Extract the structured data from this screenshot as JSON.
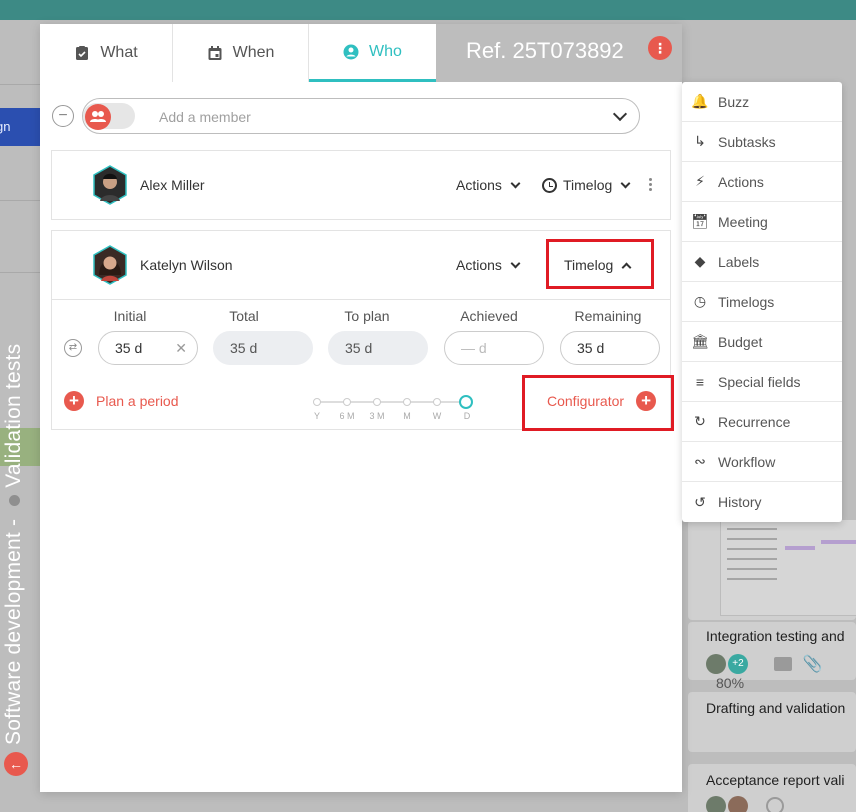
{
  "ref": "Ref. 25T073892",
  "tabs": [
    {
      "label": "What",
      "icon": "clipboard-check-icon"
    },
    {
      "label": "When",
      "icon": "calendar-icon"
    },
    {
      "label": "Who",
      "icon": "user-circle-icon"
    }
  ],
  "member_select": {
    "placeholder": "Add a member"
  },
  "members": [
    {
      "name": "Alex Miller",
      "actions_label": "Actions",
      "timelog_label": "Timelog"
    },
    {
      "name": "Katelyn Wilson",
      "actions_label": "Actions",
      "timelog_label": "Timelog"
    }
  ],
  "timelog": {
    "columns": [
      "Initial",
      "Total",
      "To plan",
      "Achieved",
      "Remaining"
    ],
    "values": [
      "35 d",
      "35 d",
      "35 d",
      "— d",
      "35 d"
    ],
    "plan_period_label": "Plan a period",
    "configurator_label": "Configurator",
    "scale": [
      "Y",
      "6 M",
      "3 M",
      "M",
      "W",
      "D"
    ]
  },
  "side_menu": [
    {
      "label": "Buzz",
      "icon": "bell-icon"
    },
    {
      "label": "Subtasks",
      "icon": "subtask-arrow-icon"
    },
    {
      "label": "Actions",
      "icon": "lightning-icon"
    },
    {
      "label": "Meeting",
      "icon": "calendar-icon"
    },
    {
      "label": "Labels",
      "icon": "tag-icon"
    },
    {
      "label": "Timelogs",
      "icon": "clock-icon"
    },
    {
      "label": "Budget",
      "icon": "bank-icon"
    },
    {
      "label": "Special fields",
      "icon": "list-icon"
    },
    {
      "label": "Recurrence",
      "icon": "refresh-icon"
    },
    {
      "label": "Workflow",
      "icon": "workflow-icon"
    },
    {
      "label": "History",
      "icon": "history-icon"
    }
  ],
  "background": {
    "project_title": "Software development - ",
    "project_subtitle": "Validation tests",
    "left_strip_text": "gn",
    "cards": [
      {
        "title": "Integration testing and",
        "badge": "+2",
        "percent": "80%"
      },
      {
        "title": "Drafting and validation"
      },
      {
        "title": "Acceptance report vali"
      }
    ]
  }
}
